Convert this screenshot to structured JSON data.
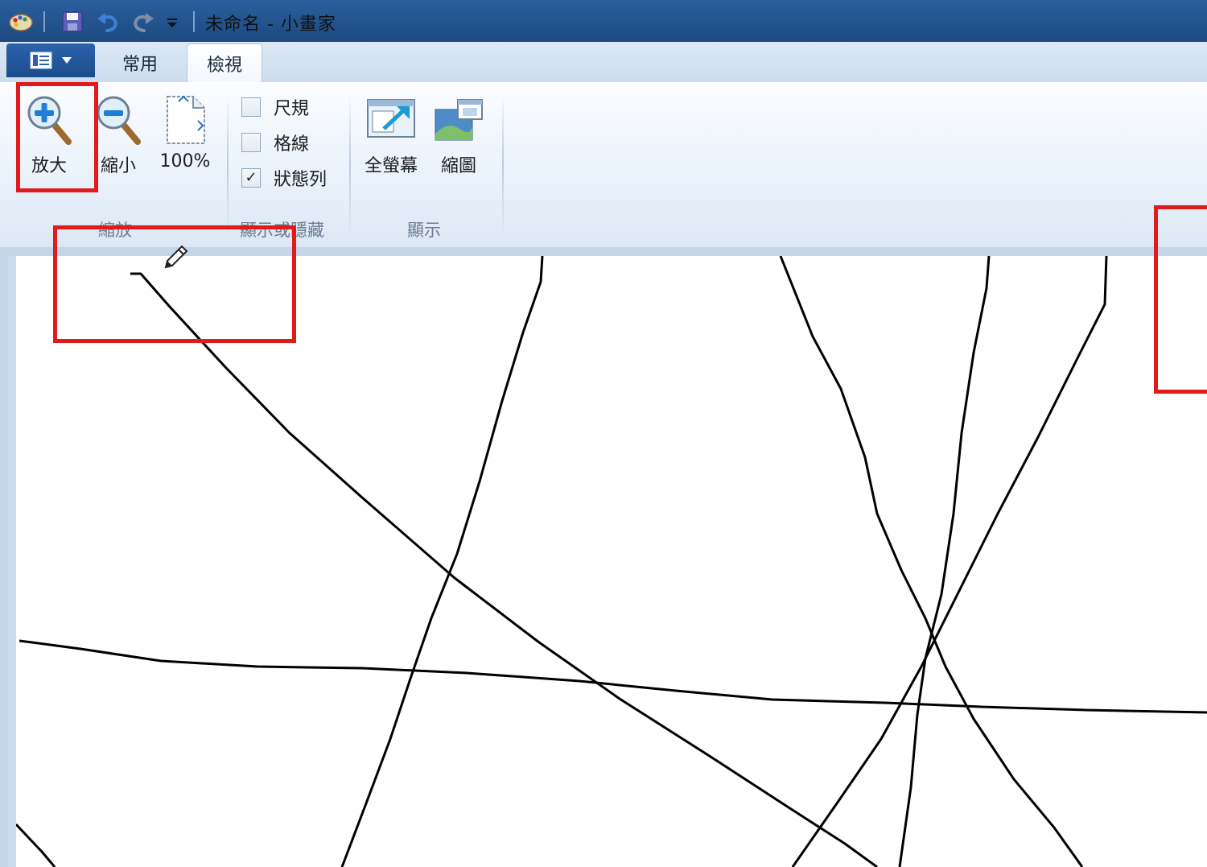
{
  "window": {
    "title": "未命名 - 小畫家"
  },
  "tabs": [
    {
      "label": "常用",
      "selected": false
    },
    {
      "label": "檢視",
      "selected": true
    }
  ],
  "ribbon": {
    "zoom_group": {
      "label": "縮放",
      "zoom_in_label": "放大",
      "zoom_out_label": "縮小",
      "actual_size_label": "100%"
    },
    "show_hide_group": {
      "label": "顯示或隱藏",
      "rulers_label": "尺規",
      "rulers_checked": false,
      "gridlines_label": "格線",
      "gridlines_checked": false,
      "statusbar_label": "狀態列",
      "statusbar_checked": true,
      "check_mark": "✓"
    },
    "display_group": {
      "label": "顯示",
      "fullscreen_label": "全螢幕",
      "thumbnail_label": "縮圖"
    }
  },
  "icons": {
    "app": "paint-palette-icon",
    "save": "save-icon",
    "undo": "undo-icon",
    "redo": "redo-icon",
    "customize": "dropdown-icon",
    "cursor": "pencil-cursor-icon"
  },
  "colors": {
    "annotation": "#e01b1b",
    "titlebar": "#1c4980",
    "ribbon": "#e6eff9"
  }
}
